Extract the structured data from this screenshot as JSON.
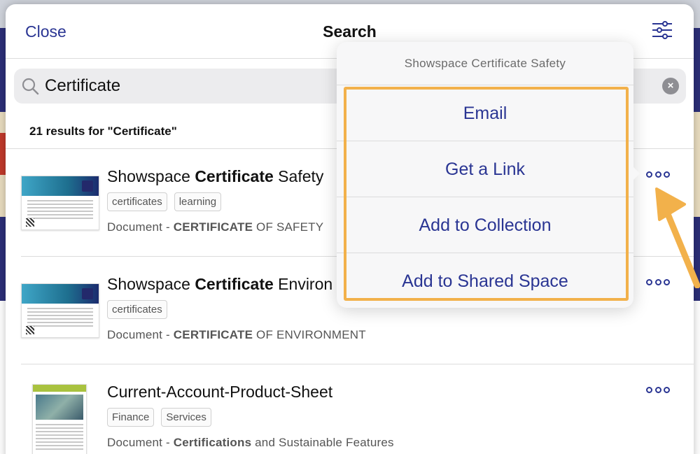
{
  "header": {
    "close_label": "Close",
    "title": "Search"
  },
  "search": {
    "value": "Certificate",
    "placeholder": ""
  },
  "results_summary": "21 results for \"Certificate\"",
  "results": [
    {
      "title_prefix": "Showspace ",
      "title_match": "Certificate",
      "title_suffix": " Safety",
      "tags": [
        "certificates",
        "learning"
      ],
      "sub_prefix": "Document - ",
      "sub_match": "CERTIFICATE",
      "sub_suffix": " OF SAFETY"
    },
    {
      "title_prefix": "Showspace ",
      "title_match": "Certificate",
      "title_suffix": " Environ",
      "tags": [
        "certificates"
      ],
      "sub_prefix": "Document - ",
      "sub_match": "CERTIFICATE",
      "sub_suffix": " OF ENVIRONMENT"
    },
    {
      "title_prefix": "Current-Account-Product-Sheet",
      "title_match": "",
      "title_suffix": "",
      "tags": [
        "Finance",
        "Services"
      ],
      "sub_prefix": "Document - ",
      "sub_match": "Certifications",
      "sub_suffix": " and Sustainable Features"
    }
  ],
  "popover": {
    "header": "Showspace Certificate Safety",
    "items": [
      "Email",
      "Get a Link",
      "Add to Collection",
      "Add to Shared Space"
    ]
  },
  "colors": {
    "accent": "#2a3593",
    "highlight": "#f2b14b",
    "background_app": "#2c2f78"
  },
  "icons": {
    "filter": "sliders-icon",
    "search": "magnifier-icon",
    "clear": "clear-circle-icon",
    "more": "ellipsis-icon"
  }
}
